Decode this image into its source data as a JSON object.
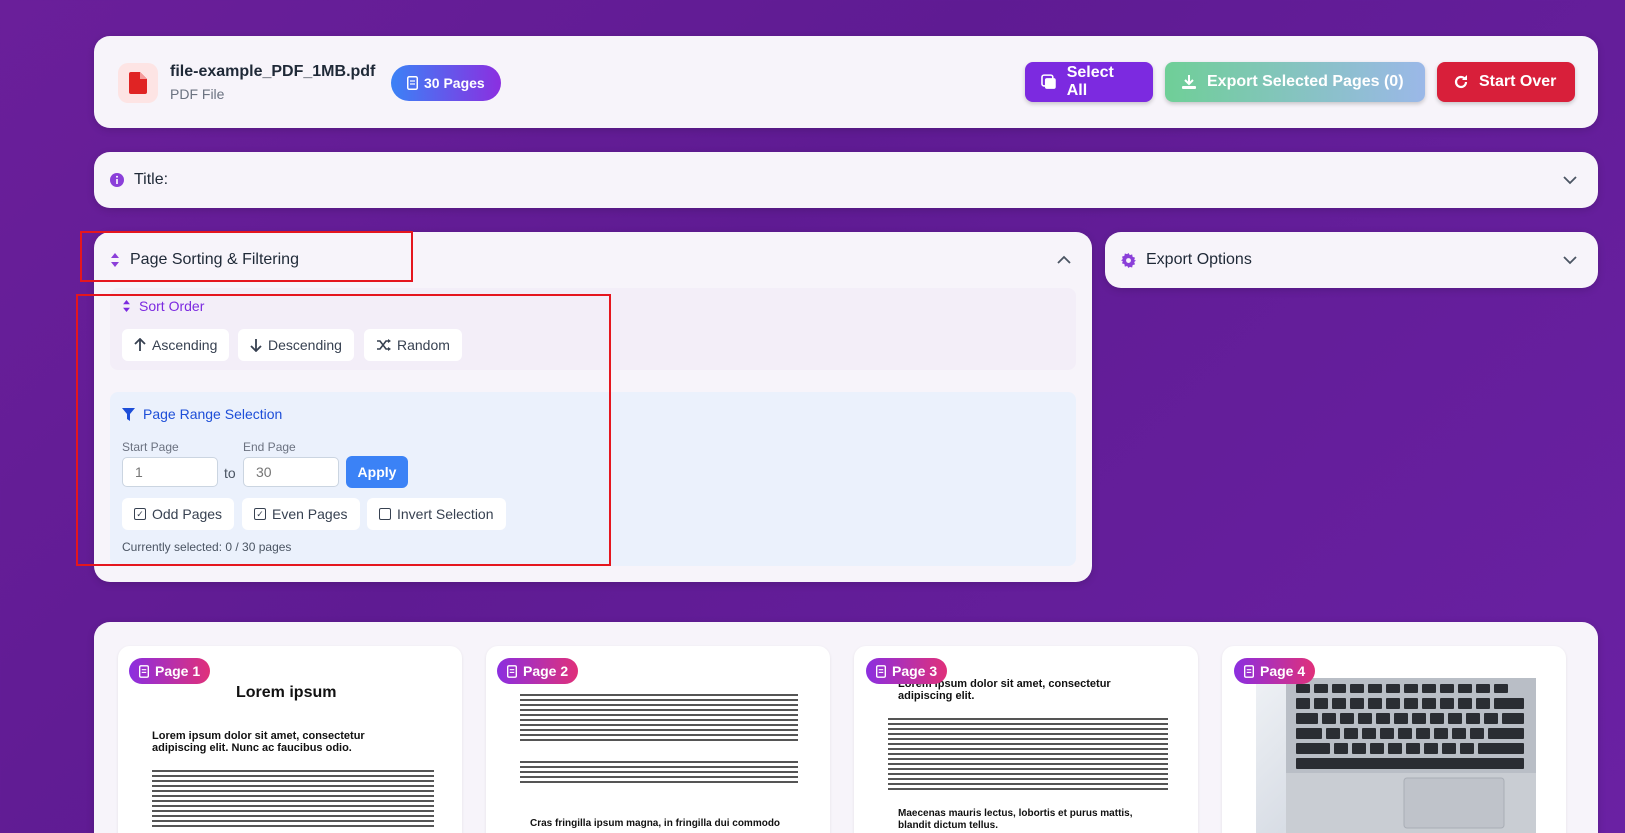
{
  "header": {
    "file_name": "file-example_PDF_1MB.pdf",
    "file_type": "PDF File",
    "pages_badge": "30 Pages",
    "select_all": "Select All",
    "export_selected": "Export Selected Pages (0)",
    "start_over": "Start Over"
  },
  "title_section": {
    "label": "Title:"
  },
  "sorting": {
    "title": "Page Sorting & Filtering",
    "sort_order_title": "Sort Order",
    "ascending": "Ascending",
    "descending": "Descending",
    "random": "Random",
    "range_title": "Page Range Selection",
    "start_label": "Start Page",
    "end_label": "End Page",
    "start_placeholder": "1",
    "end_placeholder": "30",
    "to": "to",
    "apply": "Apply",
    "odd_pages": "Odd Pages",
    "even_pages": "Even Pages",
    "invert_selection": "Invert Selection",
    "selected_status": "Currently selected: 0 / 30 pages"
  },
  "export_options": {
    "label": "Export Options"
  },
  "pages": [
    {
      "label": "Page 1",
      "heading": "Lorem ipsum",
      "subheading": "Lorem ipsum dolor sit amet, consectetur adipiscing elit. Nunc ac faucibus odio."
    },
    {
      "label": "Page 2",
      "subheading": "Cras fringilla ipsum magna, in fringilla dui commodo"
    },
    {
      "label": "Page 3",
      "heading": "Lorem ipsum dolor sit amet, consectetur adipiscing elit.",
      "subheading": "Maecenas mauris lectus, lobortis et purus mattis, blandit dictum tellus."
    },
    {
      "label": "Page 4"
    }
  ],
  "colors": {
    "accent_purple": "#7c2ae0",
    "danger_red": "#d81f3a",
    "apply_blue": "#3b82f6",
    "highlight_red": "#e5161e"
  }
}
